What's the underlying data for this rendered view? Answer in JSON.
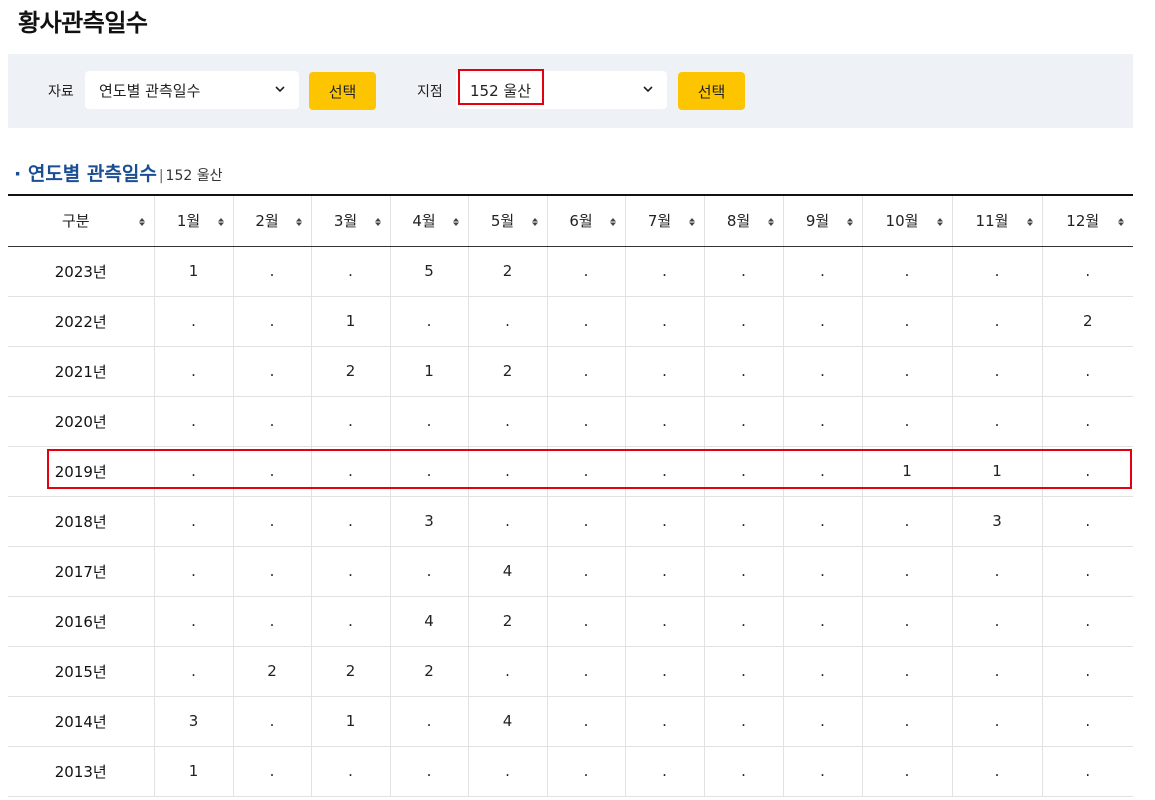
{
  "page_title": "황사관측일수",
  "filters": {
    "data_label": "자료",
    "data_value": "연도별 관측일수",
    "station_label": "지점",
    "station_value": "152 울산",
    "select_button": "선택",
    "select_button2": "선택"
  },
  "section": {
    "title": "· 연도별 관측일수",
    "bar": "|",
    "subtitle": "152 울산"
  },
  "table": {
    "headers": [
      "구분",
      "1월",
      "2월",
      "3월",
      "4월",
      "5월",
      "6월",
      "7월",
      "8월",
      "9월",
      "10월",
      "11월",
      "12월"
    ],
    "rows": [
      [
        "2023년",
        "1",
        ".",
        ".",
        "5",
        "2",
        ".",
        ".",
        ".",
        ".",
        ".",
        ".",
        "."
      ],
      [
        "2022년",
        ".",
        ".",
        "1",
        ".",
        ".",
        ".",
        ".",
        ".",
        ".",
        ".",
        ".",
        "2"
      ],
      [
        "2021년",
        ".",
        ".",
        "2",
        "1",
        "2",
        ".",
        ".",
        ".",
        ".",
        ".",
        ".",
        "."
      ],
      [
        "2020년",
        ".",
        ".",
        ".",
        ".",
        ".",
        ".",
        ".",
        ".",
        ".",
        ".",
        ".",
        "."
      ],
      [
        "2019년",
        ".",
        ".",
        ".",
        ".",
        ".",
        ".",
        ".",
        ".",
        ".",
        "1",
        "1",
        "."
      ],
      [
        "2018년",
        ".",
        ".",
        ".",
        "3",
        ".",
        ".",
        ".",
        ".",
        ".",
        ".",
        "3",
        "."
      ],
      [
        "2017년",
        ".",
        ".",
        ".",
        ".",
        "4",
        ".",
        ".",
        ".",
        ".",
        ".",
        ".",
        "."
      ],
      [
        "2016년",
        ".",
        ".",
        ".",
        "4",
        "2",
        ".",
        ".",
        ".",
        ".",
        ".",
        ".",
        "."
      ],
      [
        "2015년",
        ".",
        "2",
        "2",
        "2",
        ".",
        ".",
        ".",
        ".",
        ".",
        ".",
        ".",
        "."
      ],
      [
        "2014년",
        "3",
        ".",
        "1",
        ".",
        "4",
        ".",
        ".",
        ".",
        ".",
        ".",
        ".",
        "."
      ],
      [
        "2013년",
        "1",
        ".",
        ".",
        ".",
        ".",
        ".",
        ".",
        ".",
        ".",
        ".",
        ".",
        "."
      ]
    ]
  },
  "colors": {
    "accent_button": "#fdc500",
    "highlight_border": "#e3000f",
    "section_title": "#1b4f94"
  }
}
